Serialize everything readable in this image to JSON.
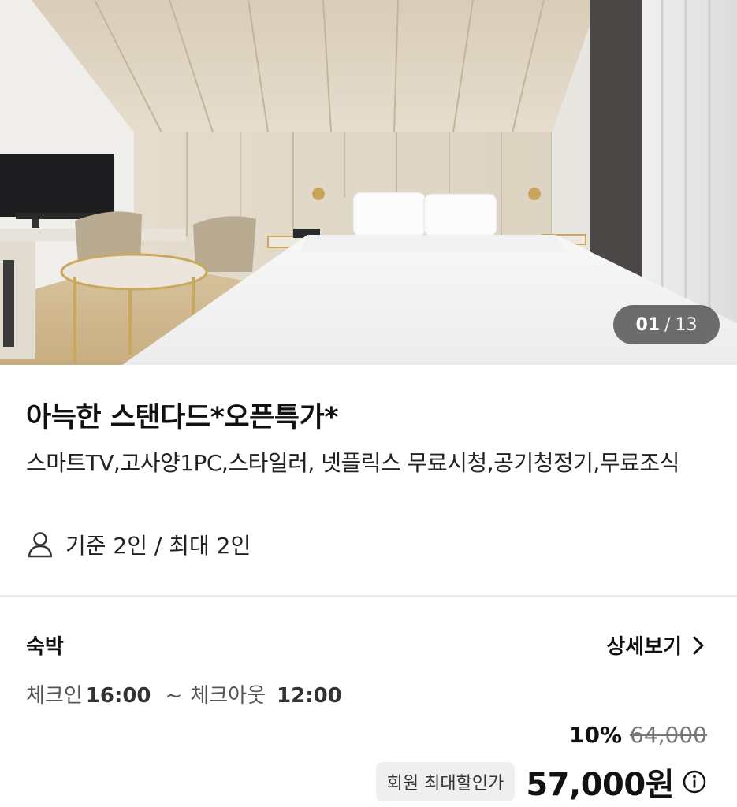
{
  "gallery": {
    "current": "01",
    "separator": "/",
    "total": "13"
  },
  "room": {
    "title": "아늑한 스탠다드*오픈특가*",
    "amenities": "스마트TV,고사양1PC,스타일러, 넷플릭스 무료시청,공기청정기,무료조식",
    "occupancy": "기준 2인 / 최대 2인",
    "occupancy_icon": "person-icon"
  },
  "rate": {
    "stay_type": "숙박",
    "detail_label": "상세보기",
    "checkin_label": "체크인",
    "checkin_time": "16:00",
    "tilde": "~",
    "checkout_label": "체크아웃",
    "checkout_time": "12:00",
    "discount_percent": "10%",
    "original_price": "64,000",
    "badge": "회원 최대할인가",
    "price": "57,000원"
  }
}
